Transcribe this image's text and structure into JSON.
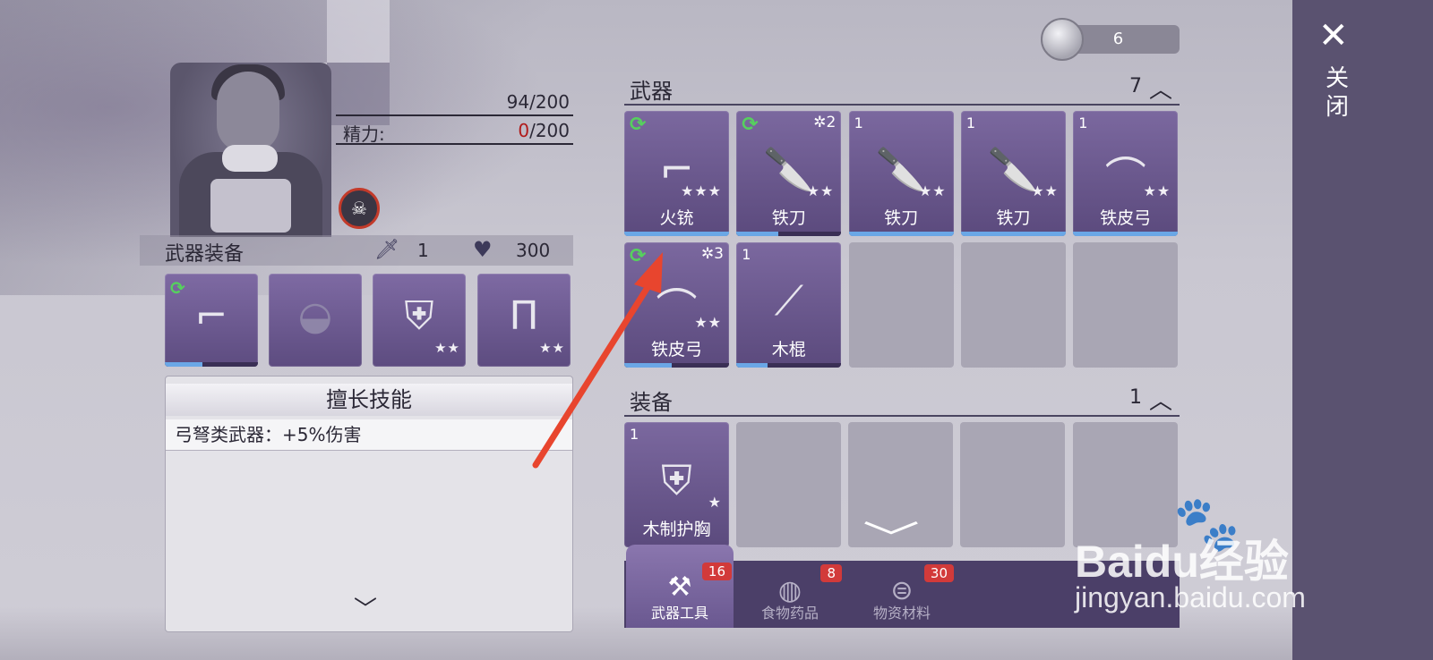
{
  "currency": {
    "value": "6"
  },
  "stats": {
    "row1_label": "",
    "row1_value": "94/200",
    "energy_label": "精力:",
    "energy_current": "0",
    "energy_max": "/200"
  },
  "equipment_bar": {
    "title": "武器装备",
    "attack": "1",
    "hp": "300"
  },
  "equip_slots": [
    {
      "name": "weapon-slot",
      "stars": "",
      "progress": 0.4
    },
    {
      "name": "hat-slot",
      "stars": "",
      "progress": 0
    },
    {
      "name": "armor-slot",
      "stars": "★★",
      "progress": 0
    },
    {
      "name": "pants-slot",
      "stars": "★★",
      "progress": 0
    }
  ],
  "skills": {
    "title": "擅长技能",
    "items": [
      "弓弩类武器：+5%伤害"
    ]
  },
  "weapons_section": {
    "title": "武器",
    "count": "7"
  },
  "weapons": [
    {
      "name": "火铳",
      "count": "",
      "gear": "",
      "stars": "★★★",
      "refresh": true,
      "progress": 1.0
    },
    {
      "name": "铁刀",
      "count": "",
      "gear": "✲2",
      "stars": "★★",
      "refresh": true,
      "progress": 0.4
    },
    {
      "name": "铁刀",
      "count": "1",
      "gear": "",
      "stars": "★★",
      "refresh": false,
      "progress": 1.0
    },
    {
      "name": "铁刀",
      "count": "1",
      "gear": "",
      "stars": "★★",
      "refresh": false,
      "progress": 1.0
    },
    {
      "name": "铁皮弓",
      "count": "1",
      "gear": "",
      "stars": "★★",
      "refresh": false,
      "progress": 1.0
    },
    {
      "name": "铁皮弓",
      "count": "",
      "gear": "✲3",
      "stars": "★★",
      "refresh": true,
      "progress": 0.45
    },
    {
      "name": "木棍",
      "count": "1",
      "gear": "",
      "stars": "",
      "refresh": false,
      "progress": 0.3
    }
  ],
  "equipment_section": {
    "title": "装备",
    "count": "1"
  },
  "equipment": [
    {
      "name": "木制护胸",
      "count": "1",
      "stars": "★"
    }
  ],
  "tabs": [
    {
      "label": "武器工具",
      "badge": "16"
    },
    {
      "label": "食物药品",
      "badge": "8"
    },
    {
      "label": "物资材料",
      "badge": "30"
    }
  ],
  "close": {
    "label": "关闭"
  },
  "watermark": {
    "brand": "Baidu经验",
    "url": "jingyan.baidu.com"
  },
  "colors": {
    "card": "#6b5890",
    "accent_red": "#e8452e",
    "progress": "#6aa7e6"
  }
}
